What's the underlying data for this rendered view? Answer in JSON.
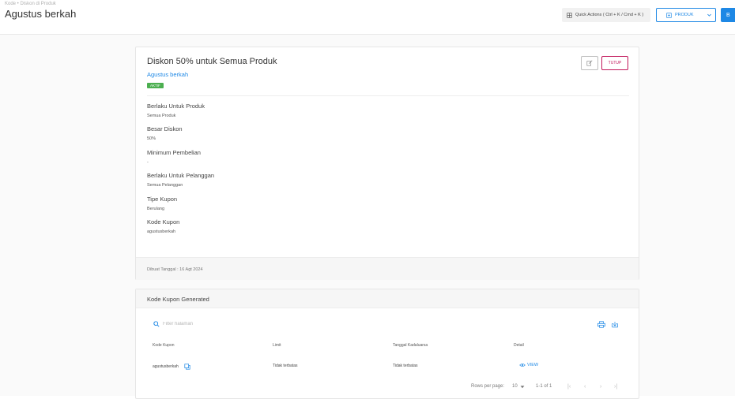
{
  "header": {
    "breadcrumb": "Kode • Diskon di Produk",
    "title": "Agustus berkah",
    "quick_actions": "Quick Actions ( Ctrl + K / Cmd + K )",
    "produk_label": "PRODUK",
    "blue_button_label": "B"
  },
  "discount": {
    "title": "Diskon 50% untuk Semua Produk",
    "store_name": "Agustus berkah",
    "status_badge": "AKTIF",
    "tutup_label": "TUTUP",
    "fields": [
      {
        "label": "Berlaku Untuk Produk",
        "value": "Semua Produk"
      },
      {
        "label": "Besar Diskon",
        "value": "50%"
      },
      {
        "label": "Minimum Pembelian",
        "value": "-"
      },
      {
        "label": "Berlaku Untuk Pelanggan",
        "value": "Semua Pelanggan"
      },
      {
        "label": "Tipe Kupon",
        "value": "Berulang"
      },
      {
        "label": "Kode Kupon",
        "value": "agustusberkah"
      }
    ],
    "created_date": "Dibuat Tanggal : 16 Agt 2024"
  },
  "coupons": {
    "section_title": "Kode Kupon Generated",
    "search_placeholder": "Filter halaman",
    "columns": [
      "Kode Kupon",
      "Limit",
      "Tanggal Kadaluarsa",
      "Detail"
    ],
    "rows": [
      {
        "code": "agustusberkah",
        "limit": "Tidak terbatas",
        "expiry": "Tidak terbatas",
        "detail": "VIEW"
      }
    ],
    "pagination": {
      "rows_per_page_label": "Rows per page:",
      "rows_per_page_value": "10",
      "range": "1-1 of 1"
    }
  },
  "colors": {
    "accent": "#1e88e5",
    "active": "#4caf50",
    "danger": "#c2185b"
  }
}
